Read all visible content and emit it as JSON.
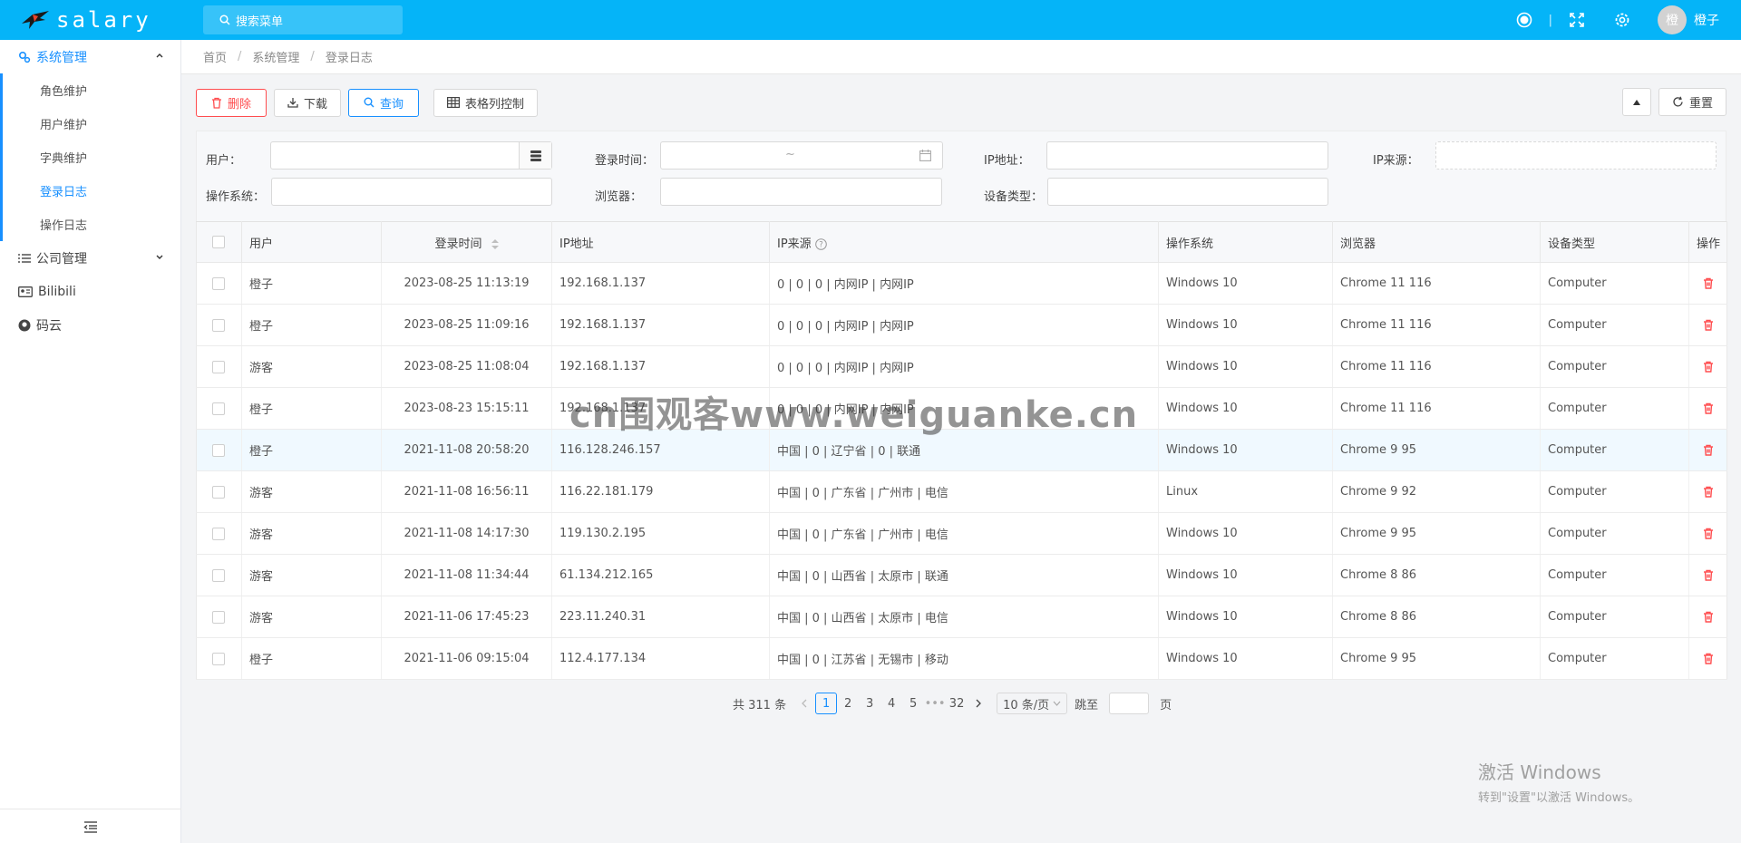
{
  "header": {
    "app_name": "salary",
    "search_placeholder": "搜索菜单",
    "username": "橙子",
    "avatar_char": "橙",
    "divider": "|"
  },
  "sidebar": {
    "groups": [
      {
        "label": "系统管理",
        "children": [
          "角色维护",
          "用户维护",
          "字典维护",
          "登录日志",
          "操作日志"
        ]
      },
      {
        "label": "公司管理"
      },
      {
        "label": "Bilibili"
      },
      {
        "label": "码云"
      }
    ],
    "active_child": "登录日志"
  },
  "breadcrumb": [
    "首页",
    "系统管理",
    "登录日志"
  ],
  "breadcrumb_sep": "/",
  "toolbar": {
    "delete": "删除",
    "download": "下载",
    "query": "查询",
    "columns": "表格列控制",
    "reset": "重置"
  },
  "filters": {
    "user": "用户：",
    "login_time": "登录时间：",
    "ip": "IP地址：",
    "ip_source": "IP来源：",
    "os": "操作系统：",
    "browser": "浏览器：",
    "device": "设备类型：",
    "range_sep": "~"
  },
  "table": {
    "headers": [
      "用户",
      "登录时间",
      "IP地址",
      "IP来源",
      "操作系统",
      "浏览器",
      "设备类型",
      "操作"
    ],
    "rows": [
      [
        "橙子",
        "2023-08-25 11:13:19",
        "192.168.1.137",
        "0 | 0 | 0 | 内网IP | 内网IP",
        "Windows 10",
        "Chrome 11 116",
        "Computer"
      ],
      [
        "橙子",
        "2023-08-25 11:09:16",
        "192.168.1.137",
        "0 | 0 | 0 | 内网IP | 内网IP",
        "Windows 10",
        "Chrome 11 116",
        "Computer"
      ],
      [
        "游客",
        "2023-08-25 11:08:04",
        "192.168.1.137",
        "0 | 0 | 0 | 内网IP | 内网IP",
        "Windows 10",
        "Chrome 11 116",
        "Computer"
      ],
      [
        "橙子",
        "2023-08-23 15:15:11",
        "192.168.1.137",
        "0 | 0 | 0 | 内网IP | 内网IP",
        "Windows 10",
        "Chrome 11 116",
        "Computer"
      ],
      [
        "橙子",
        "2021-11-08 20:58:20",
        "116.128.246.157",
        "中国 | 0 | 辽宁省 | 0 | 联通",
        "Windows 10",
        "Chrome 9 95",
        "Computer"
      ],
      [
        "游客",
        "2021-11-08 16:56:11",
        "116.22.181.179",
        "中国 | 0 | 广东省 | 广州市 | 电信",
        "Linux",
        "Chrome 9 92",
        "Computer"
      ],
      [
        "游客",
        "2021-11-08 14:17:30",
        "119.130.2.195",
        "中国 | 0 | 广东省 | 广州市 | 电信",
        "Windows 10",
        "Chrome 9 95",
        "Computer"
      ],
      [
        "游客",
        "2021-11-08 11:34:44",
        "61.134.212.165",
        "中国 | 0 | 山西省 | 太原市 | 联通",
        "Windows 10",
        "Chrome 8 86",
        "Computer"
      ],
      [
        "游客",
        "2021-11-06 17:45:23",
        "223.11.240.31",
        "中国 | 0 | 山西省 | 太原市 | 电信",
        "Windows 10",
        "Chrome 8 86",
        "Computer"
      ],
      [
        "橙子",
        "2021-11-06 09:15:04",
        "112.4.177.134",
        "中国 | 0 | 江苏省 | 无锡市 | 移动",
        "Windows 10",
        "Chrome 9 95",
        "Computer"
      ]
    ]
  },
  "pagination": {
    "total": "共 311 条",
    "pages": [
      "1",
      "2",
      "3",
      "4",
      "5",
      "•••",
      "32"
    ],
    "page_size": "10 条/页",
    "jump_label": "跳至",
    "jump_suffix": "页"
  },
  "watermark": "cn围观客www.weiguanke.cn",
  "windows_activation": {
    "title": "激活 Windows",
    "subtitle": "转到\"设置\"以激活 Windows。"
  },
  "colors": {
    "header": "#05b4f8",
    "primary": "#1890ff",
    "danger": "#ff4d4f"
  }
}
